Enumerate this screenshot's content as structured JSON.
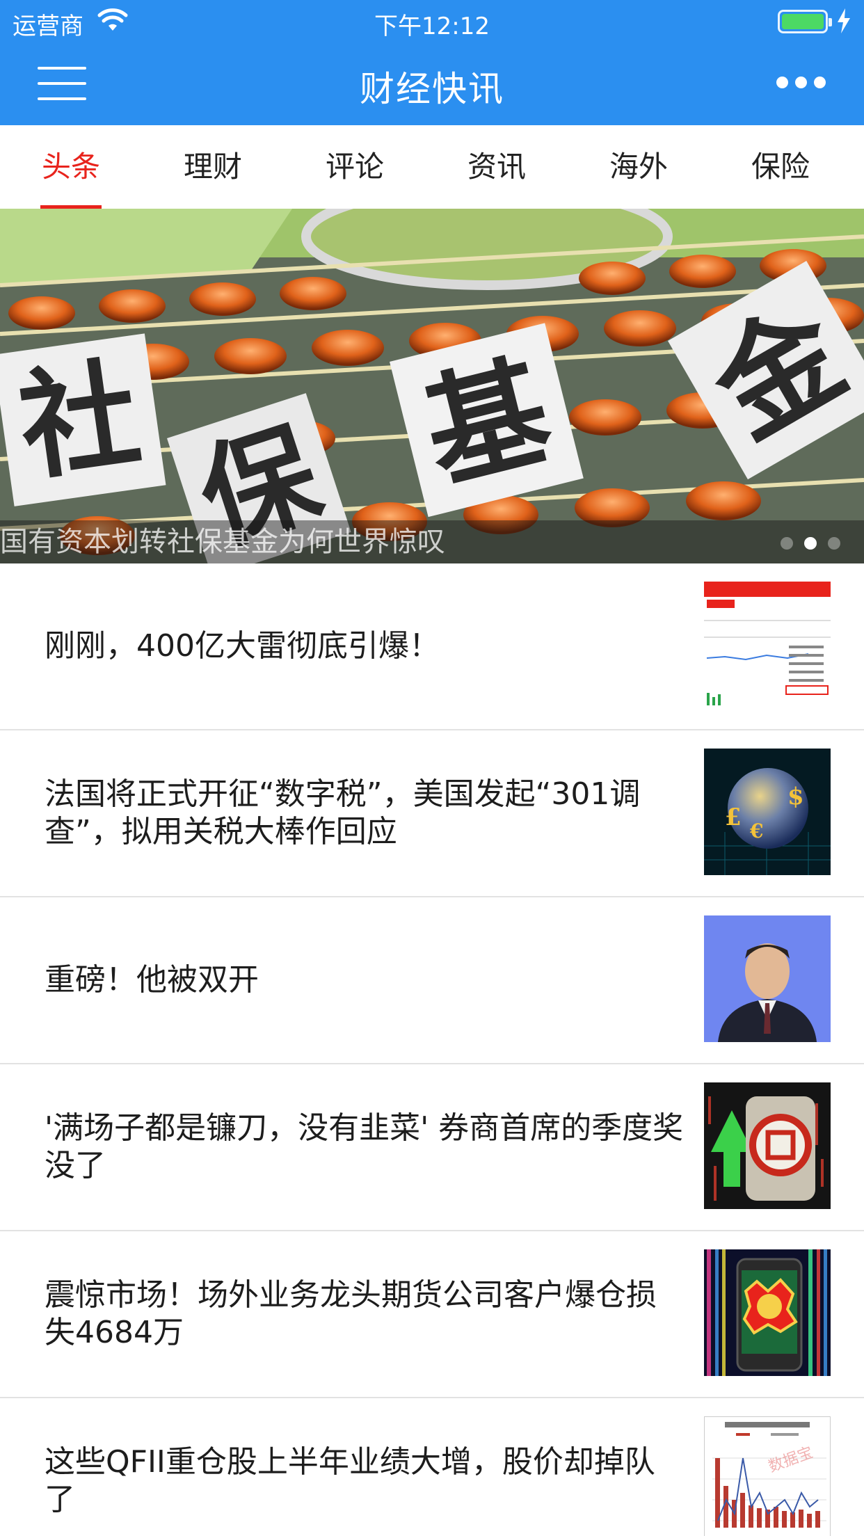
{
  "status_bar": {
    "carrier": "运营商",
    "time": "下午12:12"
  },
  "nav": {
    "title": "财经快讯"
  },
  "tabs": [
    {
      "label": "头条",
      "active": true
    },
    {
      "label": "理财",
      "active": false
    },
    {
      "label": "评论",
      "active": false
    },
    {
      "label": "资讯",
      "active": false
    },
    {
      "label": "海外",
      "active": false
    },
    {
      "label": "保险",
      "active": false
    }
  ],
  "banner": {
    "image_text": [
      "社",
      "保",
      "基",
      "金"
    ],
    "caption": "国有资本划转社保基金为何世界惊叹",
    "active_dot": 2
  },
  "news": [
    {
      "title": "刚刚，400亿大雷彻底引爆！",
      "thumb": "stock-app-screenshot"
    },
    {
      "title": "法国将正式开征“数字税”，美国发起“301调查”，拟用关税大棒作回应",
      "thumb": "globe-currency"
    },
    {
      "title": "重磅！他被双开",
      "thumb": "official-portrait"
    },
    {
      "title": "'满场子都是镰刀，没有韭菜' 券商首席的季度奖没了",
      "thumb": "fine-stamp"
    },
    {
      "title": "震惊市场！场外业务龙头期货公司客户爆仓损失4684万",
      "thumb": "phone-liquidation"
    },
    {
      "title": "这些QFII重仓股上半年业绩大增，股价却掉队了",
      "thumb": "bar-chart-report"
    }
  ],
  "colors": {
    "nav_blue": "#2b8ff0",
    "tab_active_red": "#e8231c",
    "battery_green": "#4cd964"
  }
}
